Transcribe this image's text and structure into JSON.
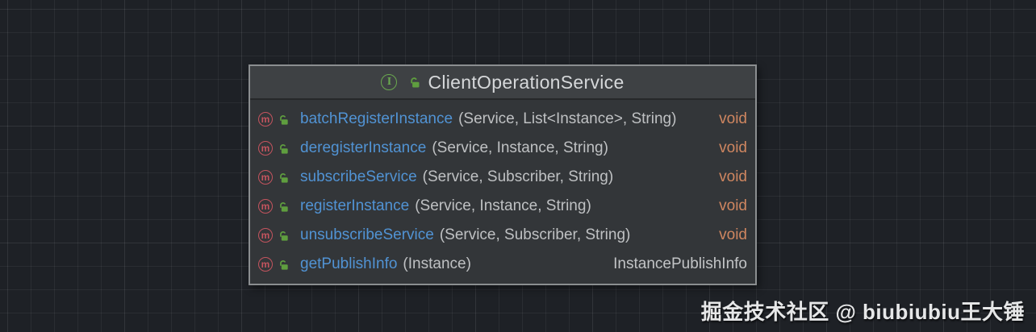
{
  "diagram": {
    "header": {
      "interface_glyph": "I",
      "title": "ClientOperationService"
    },
    "method_glyph": "m",
    "methods": [
      {
        "name": "batchRegisterInstance",
        "params": "(Service, List<Instance>, String)",
        "returns": "void"
      },
      {
        "name": "deregisterInstance",
        "params": "(Service, Instance, String)",
        "returns": "void"
      },
      {
        "name": "subscribeService",
        "params": "(Service, Subscriber, String)",
        "returns": "void"
      },
      {
        "name": "registerInstance",
        "params": "(Service, Instance, String)",
        "returns": "void"
      },
      {
        "name": "unsubscribeService",
        "params": "(Service, Subscriber, String)",
        "returns": "void"
      },
      {
        "name": "getPublishInfo",
        "params": "(Instance)",
        "returns": "InstancePublishInfo"
      }
    ]
  },
  "watermark": {
    "text": "掘金技术社区 @ biubiubiu王大锤"
  },
  "colors": {
    "background": "#1e2126",
    "box_border": "#8b8e90",
    "header_bg": "#3e4144",
    "body_bg": "#333639",
    "divider": "#26282a",
    "title_text": "#d6d8da",
    "method_name": "#5193d4",
    "params_text": "#bfc1c3",
    "void_text": "#cf8660",
    "return_type_text": "#c2c4c6",
    "method_icon": "#c4545e",
    "interface_icon": "#6aa84f",
    "lock_icon": "#5f9e3f",
    "watermark_text": "#e6e7e8"
  }
}
